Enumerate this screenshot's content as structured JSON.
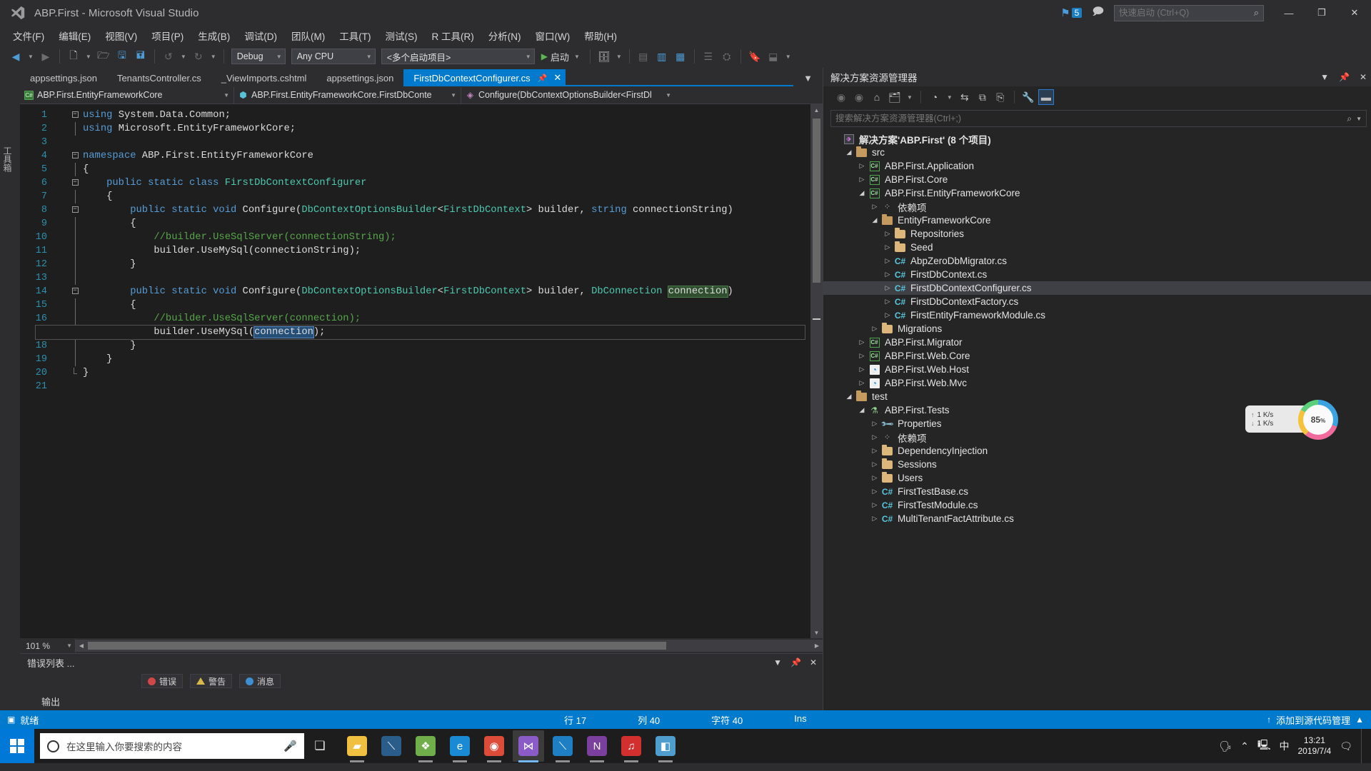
{
  "titlebar": {
    "title": "ABP.First - Microsoft Visual Studio",
    "logo_icon": "visual-studio-logo",
    "notification_count": "5",
    "feedback_icon": "feedback-icon",
    "quick_launch_placeholder": "快速启动 (Ctrl+Q)",
    "search_icon": "search-icon",
    "minimize": "—",
    "maximize": "❐",
    "close": "✕"
  },
  "menubar": {
    "items": [
      "文件(F)",
      "编辑(E)",
      "视图(V)",
      "项目(P)",
      "生成(B)",
      "调试(D)",
      "团队(M)",
      "工具(T)",
      "测试(S)",
      "R 工具(R)",
      "分析(N)",
      "窗口(W)",
      "帮助(H)"
    ]
  },
  "toolbar": {
    "nav_back_icon": "nav-back-icon",
    "nav_forward_icon": "nav-forward-icon",
    "new_project_icon": "new-project-icon",
    "open_file_icon": "open-file-icon",
    "save_icon": "save-icon",
    "save_all_icon": "save-all-icon",
    "undo_icon": "undo-icon",
    "redo_icon": "redo-icon",
    "config_value": "Debug",
    "platform_value": "Any CPU",
    "startup_value": "<多个启动项目>",
    "run_label": "启动",
    "run_icon": "play-icon",
    "step_icon": "step-icon",
    "tools_icons": [
      "window-icon",
      "columns-icon",
      "list-icon",
      "properties-icon",
      "bookmark-icon",
      "table-icon"
    ]
  },
  "editor": {
    "left_strip_label": "工具箱",
    "tabs": [
      {
        "label": "appsettings.json",
        "active": false
      },
      {
        "label": "TenantsController.cs",
        "active": false
      },
      {
        "label": "_ViewImports.cshtml",
        "active": false
      },
      {
        "label": "appsettings.json",
        "active": false
      },
      {
        "label": "FirstDbContextConfigurer.cs",
        "active": true
      }
    ],
    "tab_pin_icon": "pin-icon",
    "tab_close_icon": "close-icon",
    "tab_overflow_icon": "chevron-down-icon",
    "breadcrumb": {
      "project": "ABP.First.EntityFrameworkCore",
      "type": "ABP.First.EntityFrameworkCore.FirstDbConte",
      "member": "Configure(DbContextOptionsBuilder<FirstDl"
    },
    "line_numbers": [
      "1",
      "2",
      "3",
      "4",
      "5",
      "6",
      "7",
      "8",
      "9",
      "10",
      "11",
      "12",
      "13",
      "14",
      "15",
      "16",
      "17",
      "18",
      "19",
      "20",
      "21"
    ],
    "zoom_level": "101 %",
    "current_line_marker_icon": "edit-marker-icon"
  },
  "code": {
    "lines": [
      {
        "n": 1,
        "fold": "minus",
        "tokens": [
          {
            "t": "using ",
            "c": "k"
          },
          {
            "t": "System.Data.Common;",
            "c": "p"
          }
        ]
      },
      {
        "n": 2,
        "fold": "bar",
        "tokens": [
          {
            "t": "using ",
            "c": "k"
          },
          {
            "t": "Microsoft.EntityFrameworkCore;",
            "c": "p"
          }
        ]
      },
      {
        "n": 3,
        "fold": "",
        "tokens": []
      },
      {
        "n": 4,
        "fold": "minus",
        "tokens": [
          {
            "t": "namespace ",
            "c": "k"
          },
          {
            "t": "ABP.First.EntityFrameworkCore",
            "c": "p"
          }
        ]
      },
      {
        "n": 5,
        "fold": "bar",
        "tokens": [
          {
            "t": "{",
            "c": "p"
          }
        ]
      },
      {
        "n": 6,
        "fold": "minus",
        "tokens": [
          {
            "t": "    public static class ",
            "c": "k"
          },
          {
            "t": "FirstDbContextConfigurer",
            "c": "t"
          }
        ]
      },
      {
        "n": 7,
        "fold": "bar",
        "tokens": [
          {
            "t": "    {",
            "c": "p"
          }
        ]
      },
      {
        "n": 8,
        "fold": "minus",
        "tokens": [
          {
            "t": "        public static void ",
            "c": "k"
          },
          {
            "t": "Configure(",
            "c": "p"
          },
          {
            "t": "DbContextOptionsBuilder",
            "c": "t"
          },
          {
            "t": "<",
            "c": "p"
          },
          {
            "t": "FirstDbContext",
            "c": "t"
          },
          {
            "t": "> builder, ",
            "c": "p"
          },
          {
            "t": "string ",
            "c": "k"
          },
          {
            "t": "connectionString)",
            "c": "p"
          }
        ]
      },
      {
        "n": 9,
        "fold": "bar",
        "tokens": [
          {
            "t": "        {",
            "c": "p"
          }
        ]
      },
      {
        "n": 10,
        "fold": "bar",
        "tokens": [
          {
            "t": "            //builder.UseSqlServer(connectionString);",
            "c": "c"
          }
        ]
      },
      {
        "n": 11,
        "fold": "bar",
        "tokens": [
          {
            "t": "            builder.UseMySql(connectionString);",
            "c": "p"
          }
        ]
      },
      {
        "n": 12,
        "fold": "bar",
        "tokens": [
          {
            "t": "        }",
            "c": "p"
          }
        ]
      },
      {
        "n": 13,
        "fold": "bar",
        "tokens": []
      },
      {
        "n": 14,
        "fold": "minus",
        "tokens": [
          {
            "t": "        public static void ",
            "c": "k"
          },
          {
            "t": "Configure(",
            "c": "p"
          },
          {
            "t": "DbContextOptionsBuilder",
            "c": "t"
          },
          {
            "t": "<",
            "c": "p"
          },
          {
            "t": "FirstDbContext",
            "c": "t"
          },
          {
            "t": "> builder, ",
            "c": "p"
          },
          {
            "t": "DbConnection ",
            "c": "t"
          },
          {
            "t": "connection",
            "c": "hl"
          },
          {
            "t": ")",
            "c": "p"
          }
        ]
      },
      {
        "n": 15,
        "fold": "bar",
        "tokens": [
          {
            "t": "        {",
            "c": "p"
          }
        ]
      },
      {
        "n": 16,
        "fold": "bar",
        "tokens": [
          {
            "t": "            //builder.UseSqlServer(connection);",
            "c": "c"
          }
        ]
      },
      {
        "n": 17,
        "fold": "bar",
        "current": true,
        "tokens": [
          {
            "t": "            builder.UseMySql(",
            "c": "p"
          },
          {
            "t": "connection",
            "c": "sel"
          },
          {
            "t": ");",
            "c": "p"
          }
        ]
      },
      {
        "n": 18,
        "fold": "bar",
        "tokens": [
          {
            "t": "        }",
            "c": "p"
          }
        ]
      },
      {
        "n": 19,
        "fold": "bar",
        "tokens": [
          {
            "t": "    }",
            "c": "p"
          }
        ]
      },
      {
        "n": 20,
        "fold": "end",
        "tokens": [
          {
            "t": "}",
            "c": "p"
          }
        ]
      },
      {
        "n": 21,
        "fold": "",
        "tokens": []
      }
    ]
  },
  "error_panel": {
    "title": "错误列表 ...",
    "pin_icon": "pin-icon",
    "close_icon": "close-icon",
    "dropdown_icon": "chevron-down-icon",
    "chips": [
      {
        "label": "错误",
        "kind": "error"
      },
      {
        "label": "警告",
        "kind": "warning"
      },
      {
        "label": "消息",
        "kind": "info"
      }
    ]
  },
  "output_panel": {
    "title": "输出"
  },
  "solution_explorer": {
    "title": "解决方案资源管理器",
    "header_icons": [
      "chevron-down-icon",
      "pin-icon",
      "close-icon"
    ],
    "toolbar_icons": [
      "back-icon",
      "forward-icon",
      "home-icon",
      "pending-changes-icon",
      "chevron-down-icon",
      "scope-icon",
      "chevron-down-icon",
      "sync-icon",
      "refresh-icon",
      "collapse-all-icon",
      "show-all-files-icon",
      "properties-icon"
    ],
    "search_placeholder": "搜索解决方案资源管理器(Ctrl+;)",
    "search_icon": "search-icon",
    "tree": [
      {
        "indent": 0,
        "label": "解决方案'ABP.First' (8 个项目)",
        "arrow": "",
        "icon": "solution",
        "bold": true
      },
      {
        "indent": 1,
        "label": "src",
        "arrow": "open",
        "icon": "folder-open"
      },
      {
        "indent": 2,
        "label": "ABP.First.Application",
        "arrow": "closed",
        "icon": "csproj"
      },
      {
        "indent": 2,
        "label": "ABP.First.Core",
        "arrow": "closed",
        "icon": "csproj"
      },
      {
        "indent": 2,
        "label": "ABP.First.EntityFrameworkCore",
        "arrow": "open",
        "icon": "csproj"
      },
      {
        "indent": 3,
        "label": "依赖项",
        "arrow": "closed",
        "icon": "deps"
      },
      {
        "indent": 3,
        "label": "EntityFrameworkCore",
        "arrow": "open",
        "icon": "folder-open"
      },
      {
        "indent": 4,
        "label": "Repositories",
        "arrow": "closed",
        "icon": "folder"
      },
      {
        "indent": 4,
        "label": "Seed",
        "arrow": "closed",
        "icon": "folder"
      },
      {
        "indent": 4,
        "label": "AbpZeroDbMigrator.cs",
        "arrow": "closed",
        "icon": "cs"
      },
      {
        "indent": 4,
        "label": "FirstDbContext.cs",
        "arrow": "closed",
        "icon": "cs"
      },
      {
        "indent": 4,
        "label": "FirstDbContextConfigurer.cs",
        "arrow": "closed",
        "icon": "cs",
        "selected": true
      },
      {
        "indent": 4,
        "label": "FirstDbContextFactory.cs",
        "arrow": "closed",
        "icon": "cs"
      },
      {
        "indent": 4,
        "label": "FirstEntityFrameworkModule.cs",
        "arrow": "closed",
        "icon": "cs"
      },
      {
        "indent": 3,
        "label": "Migrations",
        "arrow": "closed",
        "icon": "folder"
      },
      {
        "indent": 2,
        "label": "ABP.First.Migrator",
        "arrow": "closed",
        "icon": "csproj"
      },
      {
        "indent": 2,
        "label": "ABP.First.Web.Core",
        "arrow": "closed",
        "icon": "csproj"
      },
      {
        "indent": 2,
        "label": "ABP.First.Web.Host",
        "arrow": "closed",
        "icon": "web"
      },
      {
        "indent": 2,
        "label": "ABP.First.Web.Mvc",
        "arrow": "closed",
        "icon": "web"
      },
      {
        "indent": 1,
        "label": "test",
        "arrow": "open",
        "icon": "folder-open"
      },
      {
        "indent": 2,
        "label": "ABP.First.Tests",
        "arrow": "open",
        "icon": "test"
      },
      {
        "indent": 3,
        "label": "Properties",
        "arrow": "closed",
        "icon": "prop"
      },
      {
        "indent": 3,
        "label": "依赖项",
        "arrow": "closed",
        "icon": "deps"
      },
      {
        "indent": 3,
        "label": "DependencyInjection",
        "arrow": "closed",
        "icon": "folder"
      },
      {
        "indent": 3,
        "label": "Sessions",
        "arrow": "closed",
        "icon": "folder"
      },
      {
        "indent": 3,
        "label": "Users",
        "arrow": "closed",
        "icon": "folder"
      },
      {
        "indent": 3,
        "label": "FirstTestBase.cs",
        "arrow": "closed",
        "icon": "cs"
      },
      {
        "indent": 3,
        "label": "FirstTestModule.cs",
        "arrow": "closed",
        "icon": "cs"
      },
      {
        "indent": 3,
        "label": "MultiTenantFactAttribute.cs",
        "arrow": "closed",
        "icon": "cs"
      }
    ]
  },
  "speed_widget": {
    "upload": "1  K/s",
    "download": "1  K/s",
    "up_icon": "arrow-up-icon",
    "down_icon": "arrow-down-icon",
    "percent": "85",
    "percent_unit": "%"
  },
  "statusbar": {
    "ready": "就绪",
    "ready_icon": "ready-icon",
    "line": "行 17",
    "column": "列 40",
    "character": "字符 40",
    "insert_mode": "Ins",
    "source_control": "添加到源代码管理",
    "source_control_icon": "arrow-up-icon",
    "expand_icon": "chevron-up-icon"
  },
  "taskbar": {
    "start_icon": "windows-start-icon",
    "search_placeholder": "在这里输入你要搜索的内容",
    "search_circle_icon": "cortana-icon",
    "mic_icon": "microphone-icon",
    "task_view_icon": "task-view-icon",
    "apps": [
      {
        "name": "file-explorer-icon",
        "glyph": "▰",
        "color": "#f0c040",
        "open": true
      },
      {
        "name": "editor-app-icon",
        "glyph": "⟍",
        "color": "#2b5d8a",
        "open": false
      },
      {
        "name": "photos-icon",
        "glyph": "❖",
        "color": "#6fae4a",
        "open": true
      },
      {
        "name": "edge-browser-icon",
        "glyph": "e",
        "color": "#1a8ad4",
        "open": true
      },
      {
        "name": "chrome-browser-icon",
        "glyph": "◉",
        "color": "#dd4b39",
        "open": true
      },
      {
        "name": "visual-studio-icon",
        "glyph": "⋈",
        "color": "#8b5cc7",
        "open": true,
        "active": true
      },
      {
        "name": "vs-code-icon",
        "glyph": "⟍",
        "color": "#1f7fc4",
        "open": true
      },
      {
        "name": "onenote-icon",
        "glyph": "N",
        "color": "#7b3f9e",
        "open": true
      },
      {
        "name": "netease-music-icon",
        "glyph": "♫",
        "color": "#d32f2f",
        "open": true
      },
      {
        "name": "paint-icon",
        "glyph": "◧",
        "color": "#4f9ccf",
        "open": true
      }
    ],
    "tray_icons": [
      "people-icon",
      "chevron-up-icon",
      "network-icon",
      "ime-icon"
    ],
    "clock_time": "13:21",
    "clock_date": "2019/7/4",
    "notification_icon": "notification-icon"
  }
}
